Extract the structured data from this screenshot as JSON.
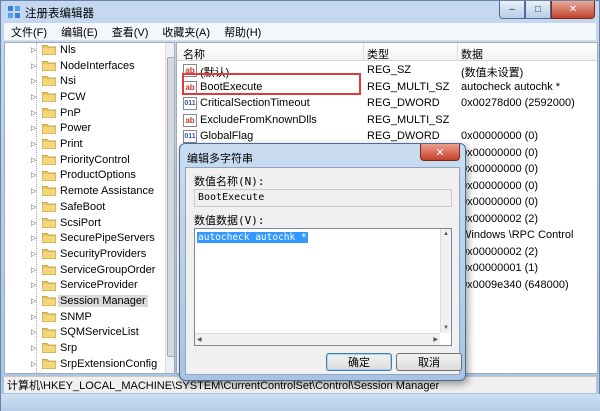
{
  "window": {
    "title": "注册表编辑器",
    "minimize": "–",
    "maximize": "□",
    "close": "✕"
  },
  "menu": [
    "文件(F)",
    "编辑(E)",
    "查看(V)",
    "收藏夹(A)",
    "帮助(H)"
  ],
  "tree": {
    "items": [
      {
        "label": "Nls"
      },
      {
        "label": "NodeInterfaces"
      },
      {
        "label": "Nsi"
      },
      {
        "label": "PCW"
      },
      {
        "label": "PnP"
      },
      {
        "label": "Power"
      },
      {
        "label": "Print"
      },
      {
        "label": "PriorityControl"
      },
      {
        "label": "ProductOptions"
      },
      {
        "label": "Remote Assistance"
      },
      {
        "label": "SafeBoot"
      },
      {
        "label": "ScsiPort"
      },
      {
        "label": "SecurePipeServers"
      },
      {
        "label": "SecurityProviders"
      },
      {
        "label": "ServiceGroupOrder"
      },
      {
        "label": "ServiceProvider"
      },
      {
        "label": "Session Manager",
        "selected": true
      },
      {
        "label": "SNMP"
      },
      {
        "label": "SQMServiceList"
      },
      {
        "label": "Srp"
      },
      {
        "label": "SrpExtensionConfig"
      }
    ]
  },
  "list": {
    "columns": {
      "name": "名称",
      "type": "类型",
      "data": "数据"
    },
    "rows": [
      {
        "icon": "sz",
        "name": "(默认)",
        "type": "REG_SZ",
        "data": "(数值未设置)"
      },
      {
        "icon": "sz",
        "name": "BootExecute",
        "type": "REG_MULTI_SZ",
        "data": "autocheck autochk *"
      },
      {
        "icon": "bin",
        "name": "CriticalSectionTimeout",
        "type": "REG_DWORD",
        "data": "0x00278d00 (2592000)"
      },
      {
        "icon": "sz",
        "name": "ExcludeFromKnownDlls",
        "type": "REG_MULTI_SZ",
        "data": ""
      },
      {
        "icon": "bin",
        "name": "GlobalFlag",
        "type": "REG_DWORD",
        "data": "0x00000000 (0)"
      },
      {
        "icon": "bin",
        "name": "",
        "type": "",
        "data": "0x00000000 (0)"
      },
      {
        "icon": "bin",
        "name": "",
        "type": "",
        "data": "0x00000000 (0)"
      },
      {
        "icon": "bin",
        "name": "",
        "type": "",
        "data": "0x00000000 (0)"
      },
      {
        "icon": "bin",
        "name": "",
        "type": "",
        "data": "0x00000000 (0)"
      },
      {
        "icon": "bin",
        "name": "",
        "type": "",
        "data": "0x00000002 (2)"
      },
      {
        "icon": "sz",
        "name": "",
        "type": "",
        "data": "Windows \\RPC Control"
      },
      {
        "icon": "bin",
        "name": "",
        "type": "",
        "data": "0x00000002 (2)"
      },
      {
        "icon": "bin",
        "name": "",
        "type": "",
        "data": "0x00000001 (1)"
      },
      {
        "icon": "bin",
        "name": "",
        "type": "",
        "data": "0x0009e340 (648000)"
      }
    ]
  },
  "statusbar": "计算机\\HKEY_LOCAL_MACHINE\\SYSTEM\\CurrentControlSet\\Control\\Session Manager",
  "dialog": {
    "title": "编辑多字符串",
    "close": "✕",
    "name_label": "数值名称(N):",
    "name_value": "BootExecute",
    "data_label": "数值数据(V):",
    "data_value": "autocheck autochk *",
    "ok": "确定",
    "cancel": "取消"
  },
  "colors": {
    "highlight_box": "#e03a3a",
    "selection": "#3399ff"
  }
}
